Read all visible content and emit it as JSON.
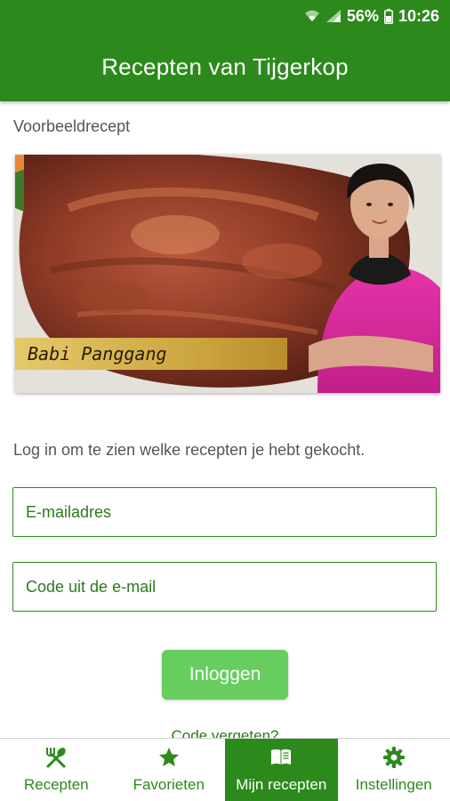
{
  "status_bar": {
    "battery": "56%",
    "time": "10:26",
    "icons": [
      "wifi-icon",
      "signal-icon",
      "battery-icon"
    ]
  },
  "app_bar": {
    "title": "Recepten van Tijgerkop"
  },
  "main": {
    "example_label": "Voorbeeldrecept",
    "recipe_caption": "Babi Panggang",
    "login_hint": "Log in om te zien welke recepten je hebt gekocht.",
    "email_placeholder": "E-mailadres",
    "code_placeholder": "Code uit de e-mail",
    "login_button": "Inloggen",
    "forgot_link": "Code vergeten?"
  },
  "bottom_nav": {
    "items": [
      {
        "label": "Recepten",
        "icon": "utensils-icon",
        "active": false
      },
      {
        "label": "Favorieten",
        "icon": "star-icon",
        "active": false
      },
      {
        "label": "Mijn recepten",
        "icon": "book-icon",
        "active": true
      },
      {
        "label": "Instellingen",
        "icon": "gear-icon",
        "active": false
      }
    ]
  },
  "colors": {
    "primary": "#2c8a1c",
    "button": "#67cd5f",
    "text_secondary": "#555555",
    "caption_gold": "#caa33c"
  }
}
